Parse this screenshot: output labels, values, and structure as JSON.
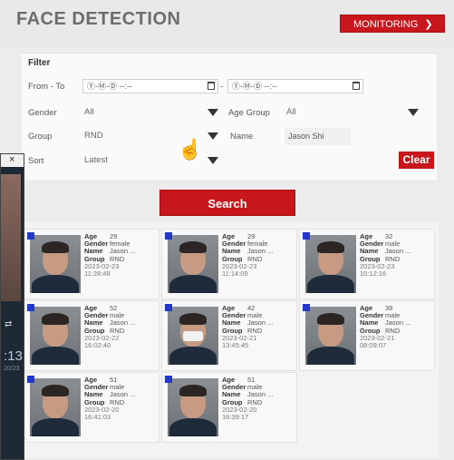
{
  "header": {
    "title": "FACE DETECTION",
    "monitoring_label": "MONITORING",
    "monitoring_arrow": "❯"
  },
  "filter": {
    "title": "Filter",
    "from_to_label": "From - To",
    "from_value": "Ⓨ-Ⓜ-Ⓓ  --:--",
    "to_value": "Ⓨ-Ⓜ-Ⓓ  --:--",
    "gender_label": "Gender",
    "gender_value": "All",
    "age_group_label": "Age Group",
    "age_group_value": "All",
    "group_label": "Group",
    "group_value": "RND",
    "name_label": "Name",
    "name_value": "Jason Shi",
    "sort_label": "Sort",
    "sort_value": "Latest",
    "clear_label": "Clear"
  },
  "search_label": "Search",
  "field_labels": {
    "age": "Age",
    "gender": "Gender",
    "name": "Name",
    "group": "Group"
  },
  "results": [
    {
      "age": "29",
      "gender": "female",
      "name": "Jason ...",
      "group": "RND",
      "date": "2023-02-23",
      "time": "11:28:48",
      "mask": false
    },
    {
      "age": "29",
      "gender": "female",
      "name": "Jason ...",
      "group": "RND",
      "date": "2023-02-23",
      "time": "11:14:09",
      "mask": false
    },
    {
      "age": "32",
      "gender": "male",
      "name": "Jason ...",
      "group": "RND",
      "date": "2023-02-23",
      "time": "10:12:16",
      "mask": false
    },
    {
      "age": "52",
      "gender": "male",
      "name": "Jason ...",
      "group": "RND",
      "date": "2023-02-22",
      "time": "16:02:40",
      "mask": false
    },
    {
      "age": "42",
      "gender": "male",
      "name": "Jason ...",
      "group": "RND",
      "date": "2023-02-21",
      "time": "13:45:45",
      "mask": true
    },
    {
      "age": "39",
      "gender": "male",
      "name": "Jason ...",
      "group": "RND",
      "date": "2023-02-21",
      "time": "08:09:07",
      "mask": false
    },
    {
      "age": "51",
      "gender": "male",
      "name": "Jason ...",
      "group": "RND",
      "date": "2023-02-20",
      "time": "16:41:03",
      "mask": false
    },
    {
      "age": "51",
      "gender": "male",
      "name": "Jason ...",
      "group": "RND",
      "date": "2023-02-20",
      "time": "16:39:17",
      "mask": false
    }
  ],
  "side_panel": {
    "close": "×",
    "clock": ":13",
    "date": "20/23",
    "swap_icon": "⇄"
  },
  "colors": {
    "accent": "#c8161d",
    "checkbox": "#2337c9"
  }
}
